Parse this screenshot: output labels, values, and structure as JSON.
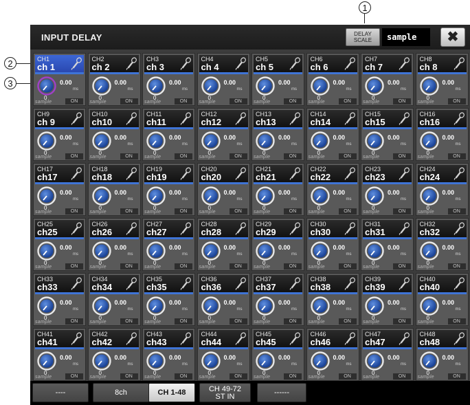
{
  "callouts": {
    "c1": "1",
    "c2": "2",
    "c3": "3"
  },
  "header": {
    "title": "INPUT DELAY",
    "delay_scale_line1": "DELAY",
    "delay_scale_line2": "SCALE",
    "delay_scale_value": "sample",
    "close_label": "✖"
  },
  "cell_defaults": {
    "delay_value": "0.00",
    "delay_unit": "ms",
    "scale_value": "0",
    "scale_label": "sample",
    "on_label": "ON"
  },
  "channels": [
    {
      "num": "CH1",
      "name": "ch 1"
    },
    {
      "num": "CH2",
      "name": "ch 2"
    },
    {
      "num": "CH3",
      "name": "ch 3"
    },
    {
      "num": "CH4",
      "name": "ch 4"
    },
    {
      "num": "CH5",
      "name": "ch 5"
    },
    {
      "num": "CH6",
      "name": "ch 6"
    },
    {
      "num": "CH7",
      "name": "ch 7"
    },
    {
      "num": "CH8",
      "name": "ch 8"
    },
    {
      "num": "CH9",
      "name": "ch 9"
    },
    {
      "num": "CH10",
      "name": "ch10"
    },
    {
      "num": "CH11",
      "name": "ch11"
    },
    {
      "num": "CH12",
      "name": "ch12"
    },
    {
      "num": "CH13",
      "name": "ch13"
    },
    {
      "num": "CH14",
      "name": "ch14"
    },
    {
      "num": "CH15",
      "name": "ch15"
    },
    {
      "num": "CH16",
      "name": "ch16"
    },
    {
      "num": "CH17",
      "name": "ch17"
    },
    {
      "num": "CH18",
      "name": "ch18"
    },
    {
      "num": "CH19",
      "name": "ch19"
    },
    {
      "num": "CH20",
      "name": "ch20"
    },
    {
      "num": "CH21",
      "name": "ch21"
    },
    {
      "num": "CH22",
      "name": "ch22"
    },
    {
      "num": "CH23",
      "name": "ch23"
    },
    {
      "num": "CH24",
      "name": "ch24"
    },
    {
      "num": "CH25",
      "name": "ch25"
    },
    {
      "num": "CH26",
      "name": "ch26"
    },
    {
      "num": "CH27",
      "name": "ch27"
    },
    {
      "num": "CH28",
      "name": "ch28"
    },
    {
      "num": "CH29",
      "name": "ch29"
    },
    {
      "num": "CH30",
      "name": "ch30"
    },
    {
      "num": "CH31",
      "name": "ch31"
    },
    {
      "num": "CH32",
      "name": "ch32"
    },
    {
      "num": "CH33",
      "name": "ch33"
    },
    {
      "num": "CH34",
      "name": "ch34"
    },
    {
      "num": "CH35",
      "name": "ch35"
    },
    {
      "num": "CH36",
      "name": "ch36"
    },
    {
      "num": "CH37",
      "name": "ch37"
    },
    {
      "num": "CH38",
      "name": "ch38"
    },
    {
      "num": "CH39",
      "name": "ch39"
    },
    {
      "num": "CH40",
      "name": "ch40"
    },
    {
      "num": "CH41",
      "name": "ch41"
    },
    {
      "num": "CH42",
      "name": "ch42"
    },
    {
      "num": "CH43",
      "name": "ch43"
    },
    {
      "num": "CH44",
      "name": "ch44"
    },
    {
      "num": "CH45",
      "name": "ch45"
    },
    {
      "num": "CH46",
      "name": "ch46"
    },
    {
      "num": "CH47",
      "name": "ch47"
    },
    {
      "num": "CH48",
      "name": "ch48"
    }
  ],
  "selected_channel": "CH1",
  "tabs": [
    {
      "line1": "----",
      "line2": ""
    },
    {
      "line1": "8ch",
      "line2": ""
    },
    {
      "line1": "CH 1-48",
      "line2": "",
      "active": true
    },
    {
      "line1": "CH 49-72",
      "line2": "ST IN"
    },
    {
      "line1": "------",
      "line2": ""
    }
  ],
  "colors": {
    "accent_blue": "#3f74d6",
    "selected_header": "#2f55c4",
    "knob_blue": "#1e5bc0",
    "selected_knob_ring": "#a040c8"
  },
  "icons": {
    "channel_icon": "microphone-icon",
    "close": "close-icon",
    "knob": "rotary-knob-icon"
  }
}
